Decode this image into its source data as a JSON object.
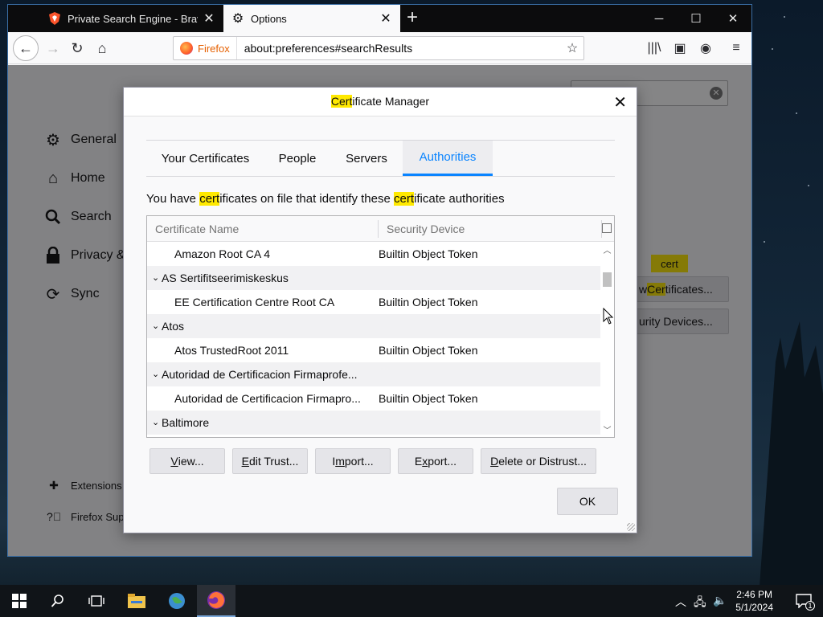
{
  "browser": {
    "tabs": [
      {
        "title": "Private Search Engine - Brave Se",
        "icon": "brave-shield-icon",
        "active": false
      },
      {
        "title": "Options",
        "icon": "gear-icon",
        "active": true
      }
    ],
    "new_tab_icon": "plus-icon",
    "url_identity_label": "Firefox",
    "url": "about:preferences#searchResults",
    "window_controls": [
      "minimize-icon",
      "maximize-icon",
      "close-icon"
    ]
  },
  "preferences": {
    "sidebar": [
      {
        "label": "General",
        "icon": "gear-icon"
      },
      {
        "label": "Home",
        "icon": "home-icon"
      },
      {
        "label": "Search",
        "icon": "search-icon"
      },
      {
        "label": "Privacy &",
        "icon": "lock-icon"
      },
      {
        "label": "Sync",
        "icon": "sync-icon"
      }
    ],
    "footer_links": [
      {
        "label": "Extensions",
        "icon": "puzzle-icon"
      },
      {
        "label": "Firefox Sup",
        "icon": "help-icon"
      }
    ],
    "search_tooltip": "cert",
    "view_certs_button": {
      "pre": "w ",
      "highlight": "Cer",
      "post": "tificates..."
    },
    "security_devices_button": "urity Devices..."
  },
  "dialog": {
    "title": {
      "highlight": "Cert",
      "rest": "ificate Manager"
    },
    "tabs": [
      "Your Certificates",
      "People",
      "Servers",
      "Authorities"
    ],
    "selected_tab": "Authorities",
    "description": {
      "p1": "You have ",
      "h1": "cert",
      "p2": "ificates on file that identify these ",
      "h2": "cert",
      "p3": "ificate authorities"
    },
    "columns": [
      "Certificate Name",
      "Security Device"
    ],
    "rows": [
      {
        "type": "item",
        "name": "Amazon Root CA 4",
        "device": "Builtin Object Token"
      },
      {
        "type": "group",
        "name": "AS Sertifitseerimiskeskus",
        "device": ""
      },
      {
        "type": "item",
        "name": "EE Certification Centre Root CA",
        "device": "Builtin Object Token"
      },
      {
        "type": "group",
        "name": "Atos",
        "device": ""
      },
      {
        "type": "item",
        "name": "Atos TrustedRoot 2011",
        "device": "Builtin Object Token"
      },
      {
        "type": "group",
        "name": "Autoridad de Certificacion Firmaprofe...",
        "device": ""
      },
      {
        "type": "item",
        "name": "Autoridad de Certificacion Firmapro...",
        "device": "Builtin Object Token"
      },
      {
        "type": "group",
        "name": "Baltimore",
        "device": ""
      }
    ],
    "buttons": [
      {
        "label": "View...",
        "access_key": "V"
      },
      {
        "label": "Edit Trust...",
        "access_key": "E"
      },
      {
        "label": "Import...",
        "access_key": "m"
      },
      {
        "label": "Export...",
        "access_key": "x"
      },
      {
        "label": "Delete or Distrust...",
        "access_key": "D"
      }
    ],
    "ok_label": "OK"
  },
  "taskbar": {
    "pinned": [
      "windows-start-icon",
      "search-icon",
      "task-view-icon",
      "file-explorer-icon",
      "network-globe-icon",
      "firefox-icon"
    ],
    "time": "2:46 PM",
    "date": "5/1/2024",
    "notification_count": "1"
  },
  "colors": {
    "accent": "#0a84ff",
    "highlight": "#ffe900",
    "tabstrip": "#0c0c0d"
  }
}
